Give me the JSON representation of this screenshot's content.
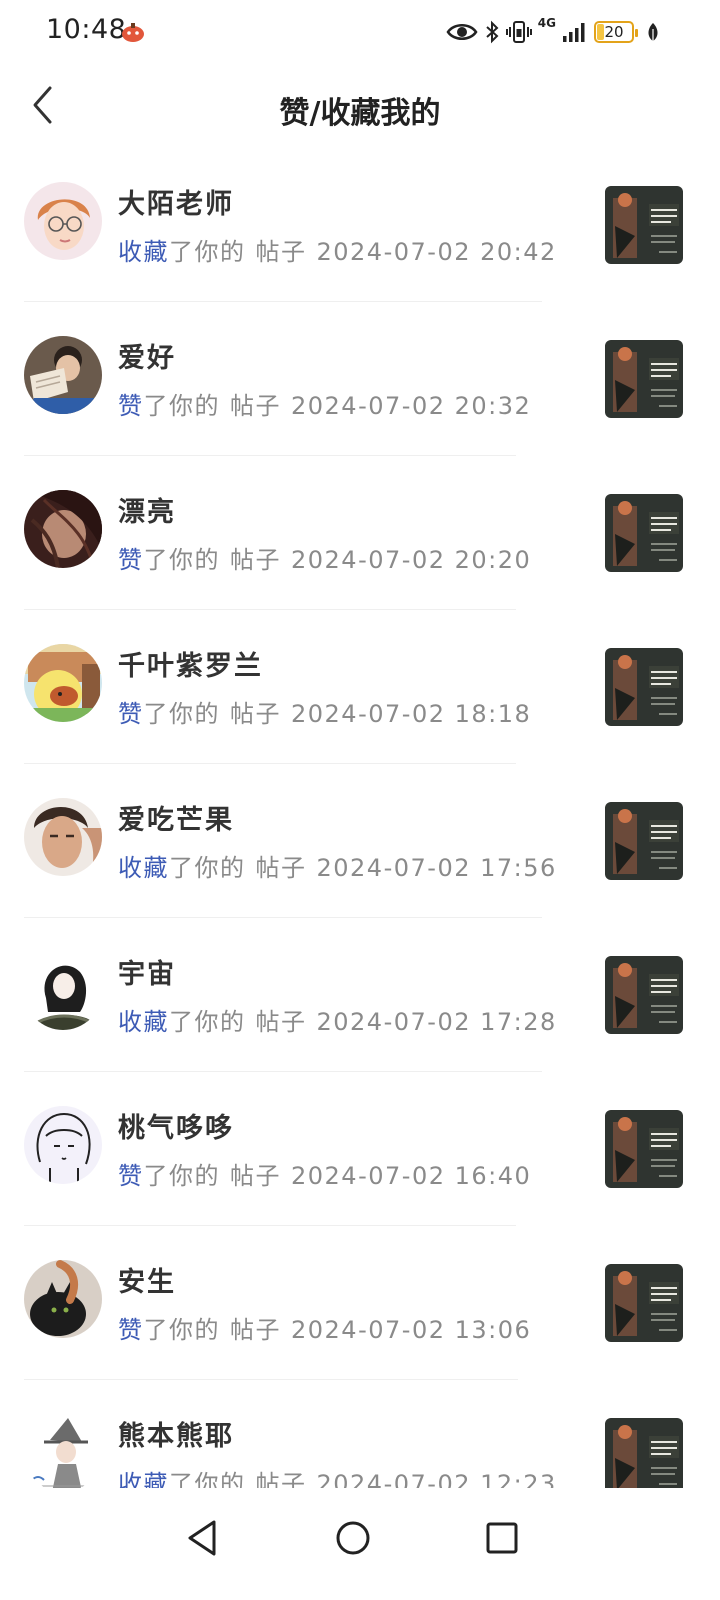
{
  "status_bar": {
    "time": "10:48",
    "network": "4G",
    "battery": "20",
    "battery_color": "#e3a31a",
    "icons": [
      "eye-icon",
      "bluetooth-icon",
      "vibrate-icon",
      "signal-icon",
      "battery-icon",
      "leaf-icon"
    ]
  },
  "header": {
    "back_icon": "chevron-left-icon",
    "title": "赞/收藏我的"
  },
  "accent_color": "#3d5bb5",
  "notifications": [
    {
      "name": "大陌老师",
      "action": "收藏",
      "suffix": "了你的",
      "object": "帖子",
      "time": "2024-07-02 20:42"
    },
    {
      "name": "爱好",
      "action": "赞",
      "suffix": "了你的",
      "object": "帖子",
      "time": "2024-07-02 20:32"
    },
    {
      "name": "漂亮",
      "action": "赞",
      "suffix": "了你的",
      "object": "帖子",
      "time": "2024-07-02 20:20"
    },
    {
      "name": "千叶紫罗兰",
      "action": "赞",
      "suffix": "了你的",
      "object": "帖子",
      "time": "2024-07-02 18:18"
    },
    {
      "name": "爱吃芒果",
      "action": "收藏",
      "suffix": "了你的",
      "object": "帖子",
      "time": "2024-07-02 17:56"
    },
    {
      "name": "宇宙",
      "action": "收藏",
      "suffix": "了你的",
      "object": "帖子",
      "time": "2024-07-02 17:28"
    },
    {
      "name": "桃气哆哆",
      "action": "赞",
      "suffix": "了你的",
      "object": "帖子",
      "time": "2024-07-02 16:40"
    },
    {
      "name": "安生",
      "action": "赞",
      "suffix": "了你的",
      "object": "帖子",
      "time": "2024-07-02 13:06"
    },
    {
      "name": "熊本熊耶",
      "action": "收藏",
      "suffix": "了你的",
      "object": "帖子",
      "time": "2024-07-02 12:23"
    }
  ],
  "nav_bar": {
    "icons": [
      "back-triangle-icon",
      "home-circle-icon",
      "recents-square-icon"
    ]
  }
}
